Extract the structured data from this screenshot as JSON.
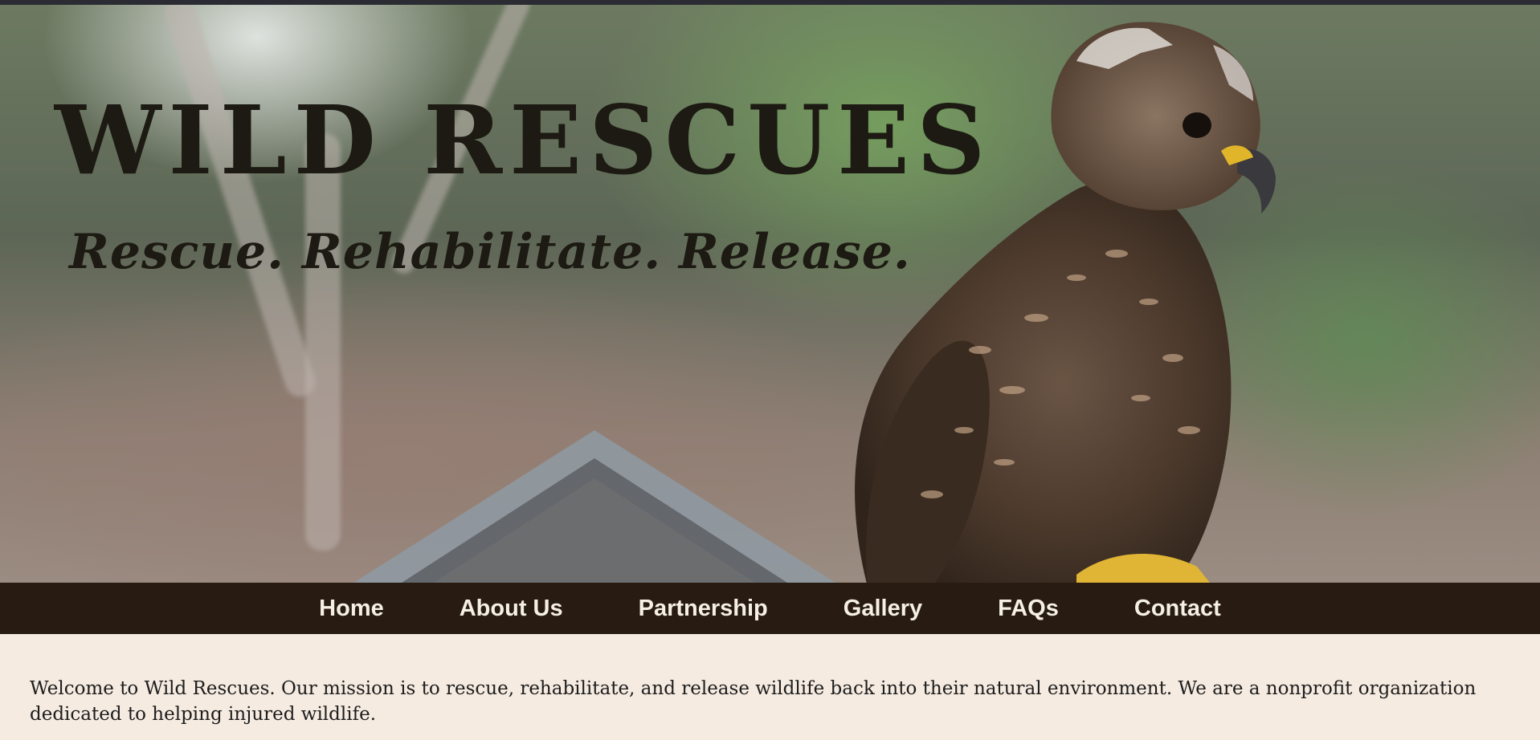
{
  "hero": {
    "title": "WILD RESCUES",
    "tagline": "Rescue. Rehabilitate. Release."
  },
  "nav": {
    "items": [
      {
        "label": "Home"
      },
      {
        "label": "About Us"
      },
      {
        "label": "Partnership"
      },
      {
        "label": "Gallery"
      },
      {
        "label": "FAQs"
      },
      {
        "label": "Contact"
      }
    ]
  },
  "main": {
    "welcome_text": "Welcome to Wild Rescues. Our mission is to rescue, rehabilitate, and release wildlife back into their natural environment. We are a nonprofit organization dedicated to helping injured wildlife."
  },
  "colors": {
    "nav_background": "#281b11",
    "nav_text": "#f5efe6",
    "page_background": "#f5ebe1",
    "title_text": "#1c1a12"
  },
  "icons": {
    "hero_image": "hawk-photo"
  }
}
